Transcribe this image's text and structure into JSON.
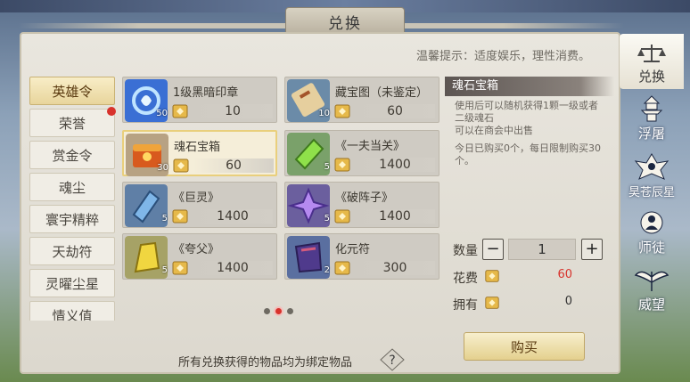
{
  "window": {
    "title": "兑换"
  },
  "tip": "温馨提示：适度娱乐，理性消费。",
  "categories": [
    {
      "label": "英雄令",
      "active": true
    },
    {
      "label": "荣誉"
    },
    {
      "label": "赏金令"
    },
    {
      "label": "魂尘"
    },
    {
      "label": "寰宇精粹"
    },
    {
      "label": "天劫符"
    },
    {
      "label": "灵曜尘星"
    },
    {
      "label": "情义值"
    }
  ],
  "items": [
    {
      "name": "1级黑暗印章",
      "qty": "50",
      "price": "10",
      "icon": "dark-seal-icon"
    },
    {
      "name": "藏宝图（未鉴定）",
      "qty": "10",
      "price": "60",
      "icon": "treasure-map-icon"
    },
    {
      "name": "魂石宝箱",
      "qty": "30",
      "price": "60",
      "icon": "soul-chest-icon",
      "selected": true
    },
    {
      "name": "《一夫当关》",
      "qty": "5",
      "price": "1400",
      "icon": "skill-book-green-icon"
    },
    {
      "name": "《巨灵》",
      "qty": "5",
      "price": "1400",
      "icon": "skill-book-blue-icon"
    },
    {
      "name": "《破阵子》",
      "qty": "5",
      "price": "1400",
      "icon": "skill-book-purple-icon"
    },
    {
      "name": "《夸父》",
      "qty": "5",
      "price": "1400",
      "icon": "skill-book-yellow-icon"
    },
    {
      "name": "化元符",
      "qty": "2",
      "price": "300",
      "icon": "talisman-icon"
    }
  ],
  "detail": {
    "title": "魂石宝箱",
    "desc": "使用后可以随机获得1颗一级或者二级魂石\n可以在商会中出售",
    "limit": "今日已购买0个，每日限制购买30个。"
  },
  "purchase": {
    "qty_label": "数量",
    "qty_value": "1",
    "minus": "−",
    "plus": "+",
    "cost_label": "花费",
    "cost_value": "60",
    "own_label": "拥有",
    "own_value": "0",
    "buy_label": "购买"
  },
  "footer_note": "所有兑换获得的物品均为绑定物品",
  "side_tabs": [
    {
      "label": "兑换",
      "icon": "scales-icon",
      "active": true
    },
    {
      "label": "浮屠",
      "icon": "pagoda-icon"
    },
    {
      "label": "昊苍辰星",
      "icon": "star-emblem-icon"
    },
    {
      "label": "师徒",
      "icon": "mentor-icon"
    },
    {
      "label": "威望",
      "icon": "wings-icon"
    }
  ],
  "colors": {
    "cost_red": "#d8322c",
    "accent_gold": "#e9cf7c"
  }
}
